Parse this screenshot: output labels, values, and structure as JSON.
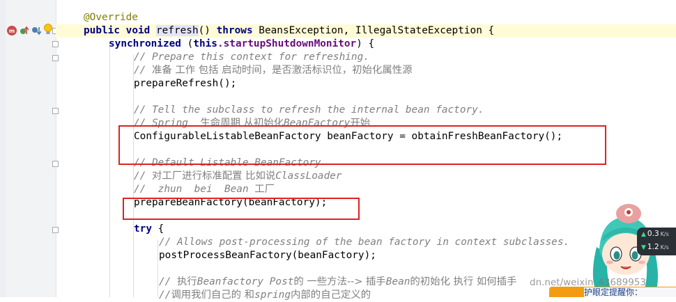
{
  "code": {
    "line1": {
      "annotation": "@Override"
    },
    "line2": {
      "kw_public": "public",
      "kw_void": "void",
      "method": "refresh",
      "paren": "() ",
      "kw_throws": "throws",
      "rest": " BeansException, IllegalStateException {"
    },
    "line3": {
      "kw_synchronized": "synchronized",
      "open": " (",
      "kw_this": "this",
      "field": ".startupShutdownMonitor",
      "close": ") {"
    },
    "line4": {
      "comment": "// Prepare this context for refreshing."
    },
    "line5": {
      "prefix": "// ",
      "cjk": "准备 工作 包括 启动时间，是否激活标识位，初始化属性源"
    },
    "line6": {
      "code": "prepareRefresh();"
    },
    "line8": {
      "comment": "// Tell the subclass to refresh the internal bean factory."
    },
    "line9": {
      "a": "// Spring  ",
      "b": "生命周期 从初始化",
      "c": "BeanFactory",
      "d": "开始"
    },
    "line10": {
      "code": "ConfigurableListableBeanFactory beanFactory = obtainFreshBeanFactory();"
    },
    "line12": {
      "comment": "// Default Listable BeanFactory"
    },
    "line13": {
      "prefix": "// ",
      "a": "对工厂进行标准配置 比如说",
      "b": "ClassLoader"
    },
    "line14": {
      "a": "//  zhun  bei  Bean ",
      "b": "工厂"
    },
    "line15": {
      "code": "prepareBeanFactory(beanFactory);"
    },
    "line17": {
      "kw_try": "try",
      "rest": " {"
    },
    "line18": {
      "comment": "// Allows post-processing of the bean factory in context subclasses."
    },
    "line19": {
      "code": "postProcessBeanFactory(beanFactory);"
    },
    "line21": {
      "prefix": "// ",
      "a": "执行",
      "b": "Beanfactory Post",
      "c": "的 一些方法--> 插手",
      "d": "Bean",
      "e": "的初始化 执行 如何插手"
    },
    "line22": {
      "prefix": "//",
      "a": "调用我们自己的 和",
      "b": "spring",
      "c": "内部的自己定义的"
    }
  },
  "net_speed": {
    "up_value": "0.3",
    "up_unit": "K/s",
    "down_value": "1.2",
    "down_unit": "K/s"
  },
  "watermark": "dn.net/weixin_43689953",
  "bottom_bar": {
    "text": "护眼定提醒你："
  },
  "colors": {
    "keyword": "#000080",
    "annotation": "#808000",
    "comment": "#808080",
    "field": "#660e7a",
    "highlight_box": "#e02020",
    "current_line": "#fffbd6"
  }
}
